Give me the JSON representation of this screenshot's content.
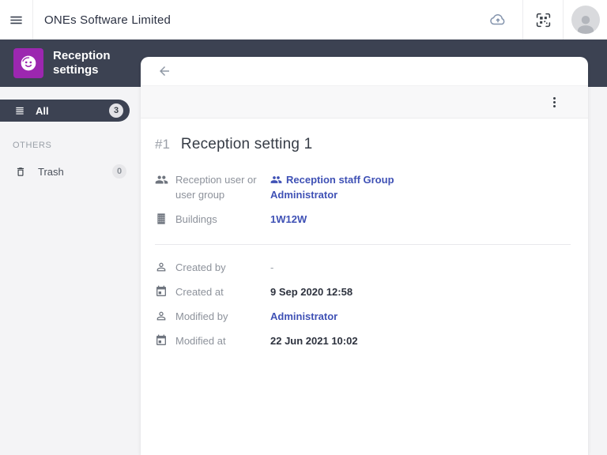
{
  "topbar": {
    "title": "ONEs Software Limited"
  },
  "module": {
    "title": "Reception settings"
  },
  "sidebar": {
    "all": {
      "label": "All",
      "count": "3",
      "selected": true
    },
    "section_label": "OTHERS",
    "trash": {
      "label": "Trash",
      "count": "0"
    }
  },
  "detail": {
    "record_number": "#1",
    "title": "Reception setting 1",
    "fields": [
      {
        "icon": "people-group-icon",
        "label": "Reception user or user group",
        "value": "Reception staff Group Administrator",
        "value_style": "link"
      },
      {
        "icon": "building-icon",
        "label": "Buildings",
        "value": "1W12W",
        "value_style": "link"
      }
    ],
    "meta": [
      {
        "icon": "person-icon",
        "label": "Created by",
        "value": "-",
        "value_style": "muted"
      },
      {
        "icon": "calendar-icon",
        "label": "Created at",
        "value": "9 Sep 2020 12:58",
        "value_style": "strong"
      },
      {
        "icon": "person-icon",
        "label": "Modified by",
        "value": "Administrator",
        "value_style": "link"
      },
      {
        "icon": "calendar-icon",
        "label": "Modified at",
        "value": "22 Jun 2021 10:02",
        "value_style": "strong"
      }
    ]
  },
  "colors": {
    "band": "#3c4252",
    "accent": "#9c27b0",
    "link": "#3f51b5",
    "page_bg": "#f4f4f6"
  }
}
